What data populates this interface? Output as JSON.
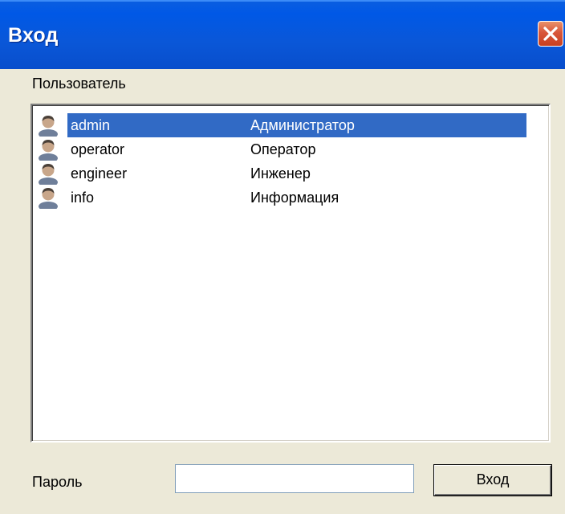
{
  "window": {
    "title": "Вход",
    "title_color": "#0a57d8",
    "close_color": "#d8563a"
  },
  "users_label": "Пользователь",
  "users": [
    {
      "login": "admin",
      "role": "Администратор",
      "selected": true,
      "icon": "user-icon"
    },
    {
      "login": "operator",
      "role": "Оператор",
      "selected": false,
      "icon": "user-icon"
    },
    {
      "login": "engineer",
      "role": "Инженер",
      "selected": false,
      "icon": "user-icon"
    },
    {
      "login": "info",
      "role": "Информация",
      "selected": false,
      "icon": "user-icon"
    }
  ],
  "password": {
    "label": "Пароль",
    "value": ""
  },
  "login_button": {
    "label": "Вход"
  },
  "colors": {
    "selection": "#316ac5",
    "face": "#ece9d8"
  }
}
